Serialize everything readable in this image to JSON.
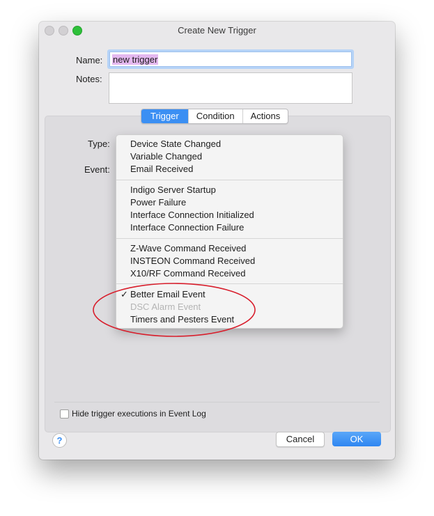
{
  "window": {
    "title": "Create New Trigger",
    "traffic_colors": {
      "close": "#d2d0d3",
      "minimize": "#d2d0d3",
      "zoom": "#2ec03a"
    }
  },
  "form": {
    "name_label": "Name:",
    "name_value": "new trigger",
    "notes_label": "Notes:",
    "notes_value": "",
    "type_label": "Type:",
    "event_label": "Event:"
  },
  "tabs": [
    {
      "label": "Trigger",
      "active": true
    },
    {
      "label": "Condition",
      "active": false
    },
    {
      "label": "Actions",
      "active": false
    }
  ],
  "menu": {
    "groups": [
      [
        {
          "label": "Device State Changed"
        },
        {
          "label": "Variable Changed"
        },
        {
          "label": "Email Received"
        }
      ],
      [
        {
          "label": "Indigo Server Startup"
        },
        {
          "label": "Power Failure"
        },
        {
          "label": "Interface Connection Initialized"
        },
        {
          "label": "Interface Connection Failure"
        }
      ],
      [
        {
          "label": "Z-Wave Command Received"
        },
        {
          "label": "INSTEON Command Received"
        },
        {
          "label": "X10/RF Command Received"
        }
      ],
      [
        {
          "label": "Better Email Event",
          "checked": true
        },
        {
          "label": "DSC Alarm Event",
          "disabled": true
        },
        {
          "label": "Timers and Pesters Event"
        }
      ]
    ],
    "checkmark": "✓"
  },
  "footer": {
    "hide_checkbox_label": "Hide trigger executions in Event Log",
    "hide_checkbox_checked": false,
    "help_glyph": "?",
    "cancel_label": "Cancel",
    "ok_label": "OK"
  },
  "colors": {
    "accent": "#3b8ff3",
    "annotation": "#d81e2c"
  }
}
